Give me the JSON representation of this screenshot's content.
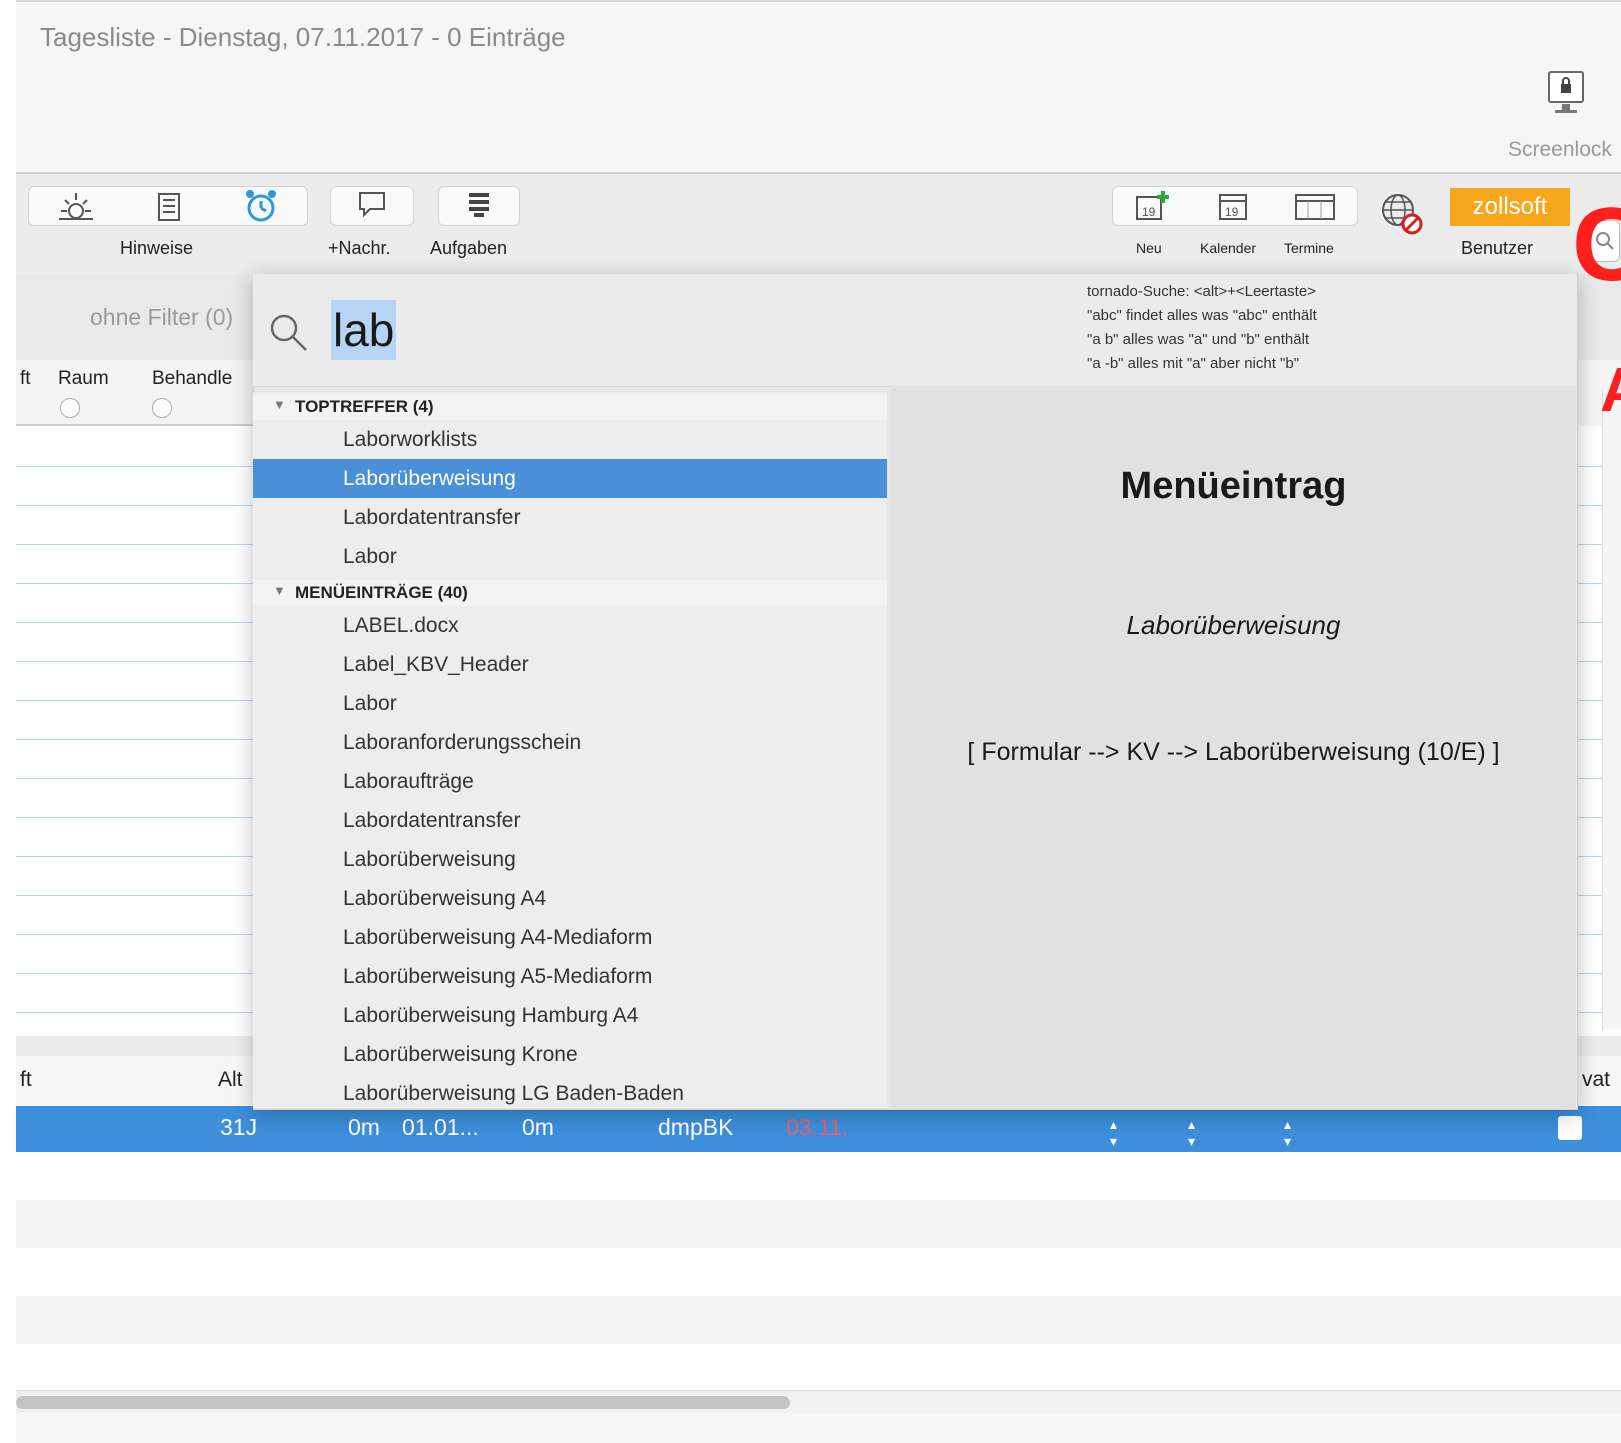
{
  "window": {
    "title": "Tagesliste - Dienstag, 07.11.2017 - 0 Einträge",
    "screenlock_label": "Screenlock"
  },
  "toolbar": {
    "hinweise_label": "Hinweise",
    "nachr_label": "+Nachr.",
    "aufgaben_label": "Aufgaben",
    "neu_label": "Neu",
    "kalender_label": "Kalender",
    "termine_label": "Termine",
    "calendar_day": "19",
    "brand": "zollsoft",
    "benutzer_label": "Benutzer"
  },
  "filter": {
    "label": "ohne Filter (0)"
  },
  "table": {
    "col_ft": "ft",
    "col_raum": "Raum",
    "col_behandler": "Behandle",
    "lower_col_ft": "ft",
    "lower_col_alter": "Alt",
    "lower_col_privat": "vat",
    "selected_row": {
      "age": "31J",
      "m1": "0m",
      "date": "01.01...",
      "m2": "0m",
      "code": "dmpBK",
      "red_date": "03.11."
    }
  },
  "popup": {
    "query": "lab",
    "help_lines": [
      "tornado-Suche: <alt>+<Leertaste>",
      "\"abc\" findet alles was \"abc\" enthält",
      "\"a b\" alles was \"a\" und \"b\" enthält",
      "\"a -b\" alles mit \"a\" aber nicht \"b\""
    ],
    "section_top": "TOPTREFFER (4)",
    "top_items": [
      "Laborworklists",
      "Laborüberweisung",
      "Labordatentransfer",
      "Labor"
    ],
    "selected_index": 1,
    "section_menu": "MENÜEINTRÄGE (40)",
    "menu_items": [
      "LABEL.docx",
      "Label_KBV_Header",
      "Labor",
      "Laboranforderungsschein",
      "Laboraufträge",
      "Labordatentransfer",
      "Laborüberweisung",
      "Laborüberweisung A4",
      "Laborüberweisung A4-Mediaform",
      "Laborüberweisung A5-Mediaform",
      "Laborüberweisung Hamburg A4",
      "Laborüberweisung Krone",
      "Laborüberweisung LG Baden-Baden"
    ],
    "detail": {
      "heading": "Menüeintrag",
      "name": "Laborüberweisung",
      "path": "[ Formular --> KV --> Laborüberweisung (10/E) ]"
    }
  },
  "annotation": {
    "letter_c": "C",
    "letter_a": "A"
  },
  "colors": {
    "selection_blue": "#4b8fd8",
    "brand_orange": "#f6a71c",
    "annotation_red": "#ff1f1f"
  }
}
